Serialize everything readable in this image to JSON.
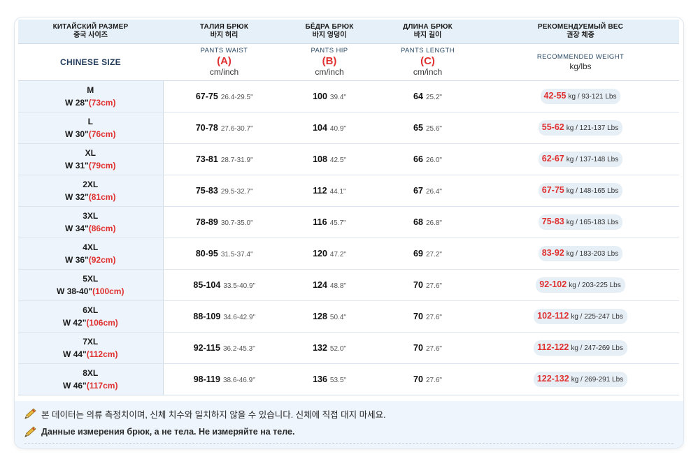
{
  "header": {
    "columns": [
      {
        "ru": "КИТАЙСКИЙ РАЗМЕР",
        "ko": "중국 사이즈",
        "en": "CHINESE SIZE"
      },
      {
        "ru": "ТАЛИЯ БРЮК",
        "ko": "바지 허리",
        "en": "PANTS WAIST",
        "letter": "(A)",
        "unit": "cm/inch"
      },
      {
        "ru": "БЁДРА БРЮК",
        "ko": "바지 엉덩이",
        "en": "PANTS HIP",
        "letter": "(B)",
        "unit": "cm/inch"
      },
      {
        "ru": "ДЛИНА БРЮК",
        "ko": "바지 길이",
        "en": "PANTS LENGTH",
        "letter": "(C)",
        "unit": "cm/inch"
      },
      {
        "ru": "РЕКОМЕНДУЕМЫЙ ВЕС",
        "ko": "권장 체중",
        "en": "RECOMMENDED WEIGHT",
        "unit": "kg/lbs"
      }
    ]
  },
  "rows": [
    {
      "size": "M",
      "w_prefix": "W 28\"",
      "w_cm": "(73cm)",
      "waist": "67-75",
      "waist_in": "26.4-29.5\"",
      "hip": "100",
      "hip_in": "39.4\"",
      "length": "64",
      "length_in": "25.2\"",
      "kg": "42-55",
      "lbs": "kg / 93-121 Lbs"
    },
    {
      "size": "L",
      "w_prefix": "W 30\"",
      "w_cm": "(76cm)",
      "waist": "70-78",
      "waist_in": "27.6-30.7\"",
      "hip": "104",
      "hip_in": "40.9\"",
      "length": "65",
      "length_in": "25.6\"",
      "kg": "55-62",
      "lbs": "kg / 121-137 Lbs"
    },
    {
      "size": "XL",
      "w_prefix": "W 31\"",
      "w_cm": "(79cm)",
      "waist": "73-81",
      "waist_in": "28.7-31.9\"",
      "hip": "108",
      "hip_in": "42.5\"",
      "length": "66",
      "length_in": "26.0\"",
      "kg": "62-67",
      "lbs": "kg / 137-148 Lbs"
    },
    {
      "size": "2XL",
      "w_prefix": "W 32\"",
      "w_cm": "(81cm)",
      "waist": "75-83",
      "waist_in": "29.5-32.7\"",
      "hip": "112",
      "hip_in": "44.1\"",
      "length": "67",
      "length_in": "26.4\"",
      "kg": "67-75",
      "lbs": "kg / 148-165 Lbs"
    },
    {
      "size": "3XL",
      "w_prefix": "W 34\"",
      "w_cm": "(86cm)",
      "waist": "78-89",
      "waist_in": "30.7-35.0\"",
      "hip": "116",
      "hip_in": "45.7\"",
      "length": "68",
      "length_in": "26.8\"",
      "kg": "75-83",
      "lbs": "kg / 165-183 Lbs"
    },
    {
      "size": "4XL",
      "w_prefix": "W 36\"",
      "w_cm": "(92cm)",
      "waist": "80-95",
      "waist_in": "31.5-37.4\"",
      "hip": "120",
      "hip_in": "47.2\"",
      "length": "69",
      "length_in": "27.2\"",
      "kg": "83-92",
      "lbs": "kg / 183-203 Lbs"
    },
    {
      "size": "5XL",
      "w_prefix": "W 38-40\"",
      "w_cm": "(100cm)",
      "waist": "85-104",
      "waist_in": "33.5-40.9\"",
      "hip": "124",
      "hip_in": "48.8\"",
      "length": "70",
      "length_in": "27.6\"",
      "kg": "92-102",
      "lbs": "kg / 203-225 Lbs"
    },
    {
      "size": "6XL",
      "w_prefix": "W 42\"",
      "w_cm": "(106cm)",
      "waist": "88-109",
      "waist_in": "34.6-42.9\"",
      "hip": "128",
      "hip_in": "50.4\"",
      "length": "70",
      "length_in": "27.6\"",
      "kg": "102-112",
      "lbs": "kg / 225-247 Lbs"
    },
    {
      "size": "7XL",
      "w_prefix": "W 44\"",
      "w_cm": "(112cm)",
      "waist": "92-115",
      "waist_in": "36.2-45.3\"",
      "hip": "132",
      "hip_in": "52.0\"",
      "length": "70",
      "length_in": "27.6\"",
      "kg": "112-122",
      "lbs": "kg / 247-269 Lbs"
    },
    {
      "size": "8XL",
      "w_prefix": "W 46\"",
      "w_cm": "(117cm)",
      "waist": "98-119",
      "waist_in": "38.6-46.9\"",
      "hip": "136",
      "hip_in": "53.5\"",
      "length": "70",
      "length_in": "27.6\"",
      "kg": "122-132",
      "lbs": "kg / 269-291 Lbs"
    }
  ],
  "notes": {
    "ko": "본 데이터는 의류 측정치이며, 신체 치수와 일치하지 않을 수 있습니다. 신체에 직접 대지 마세요.",
    "ru": "Данные измерения брюк, а не тела. Не измеряйте на теле.",
    "icon": "pencil-icon"
  },
  "colors": {
    "accent_red": "#e03030",
    "header_bg": "#e6f0f8",
    "size_col_bg": "#edf4fb",
    "pill_bg": "#e7eff6",
    "footer_bg": "#eef5fc"
  }
}
